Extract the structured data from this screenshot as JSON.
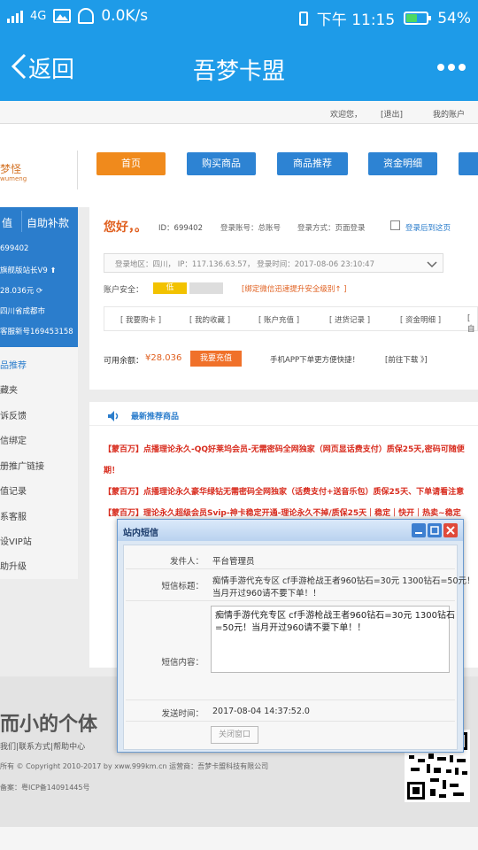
{
  "status_bar": {
    "network": "4G",
    "speed": "0.0K/s",
    "time": "下午 11:15",
    "battery": "54%",
    "battery_level": 0.54
  },
  "nav": {
    "back_label": "返回",
    "title": "吾梦卡盟"
  },
  "top_links": {
    "welcome": "欢迎您，",
    "logout": "[退出]",
    "my_account": "我的账户"
  },
  "header": {
    "logo": "梦怪",
    "nav_buttons": [
      "首页",
      "购买商品",
      "商品推荐",
      "资金明细"
    ]
  },
  "sidebar": {
    "head_left": "值",
    "head_right": "自助补款",
    "info": [
      "699402",
      "旗舰版站长V9",
      "28.036元",
      "四川省成都市",
      "客服新号169453158"
    ],
    "menu": [
      "品推荐",
      "藏夹",
      "诉反馈",
      "信绑定",
      "册推广链接",
      "值记录",
      "系客服",
      "设VIP站",
      "助升级"
    ]
  },
  "account": {
    "greeting": "您好，。",
    "id_text": "ID：699402",
    "login_account": "登录账号：总账号",
    "login_method": "登录方式：页面登录",
    "login_back": "登录后到这页",
    "login_info": "登录地区：四川， IP：117.136.63.57， 登录时间：2017-08-06 23:10:47",
    "security_label": "账户安全：",
    "security_level": "低",
    "security_tip": "[绑定微信迅速提升安全级别↑ ]",
    "quick_links": [
      "[ 我要购卡 ]",
      "[ 我的收藏 ]",
      "[ 账户充值 ]",
      "[ 进货记录 ]",
      "[ 资金明细 ]",
      "[ 自"
    ],
    "balance_label": "可用余额：",
    "balance_value": "¥28.036",
    "recharge_btn": "我要充值",
    "app_tip": "手机APP下单更方便快捷！",
    "download": "[前往下载 》]"
  },
  "recommend": {
    "title": "最新推荐商品",
    "items": [
      "【蒙百万】点播理论永久-QQ好莱坞会员-无需密码全网独家（网页显话费支付）质保25天,密码可随便",
      "期！",
      "【蒙百万】点播理论永久豪华绿钻无需密码全网独家（话费支付+送音乐包）质保25天、下单请看注意",
      "【蒙百万】理论永久超级会员Svip-神卡稳定开通-理论永久不掉/质保25天｜稳定｜快开｜热卖~稳定"
    ]
  },
  "footer": {
    "slogan": "而小的个体",
    "links": "我们|联系方式|帮助中心",
    "copyright": "所有 © Copyright 2010-2017 by xww.999km.cn 运营商：吾梦卡盟科技有限公司",
    "icp": "备案：粤ICP备14091445号"
  },
  "modal": {
    "title": "站内短信",
    "sender_label": "发件人：",
    "sender": "平台管理员",
    "subject_label": "短信标题：",
    "subject_line1": "痴情手游代充专区  cf手游枪战王者960钻石=30元  1300钻石=50元！",
    "subject_line2": "当月开过960请不要下单！！",
    "content_label": "短信内容：",
    "content_line1": "痴情手游代充专区  cf手游枪战王者960钻石=30元  1300钻石",
    "content_line2": "=50元！当月开过960请不要下单！！",
    "time_label": "发送时间：",
    "time": "2017-08-04 14:37:52.0",
    "close_btn": "关闭窗口"
  },
  "colors": {
    "brand_blue": "#1e9be8",
    "nav_orange": "#f08a1c",
    "nav_blue": "#2d83d3",
    "promo_red": "#d82c1e"
  }
}
